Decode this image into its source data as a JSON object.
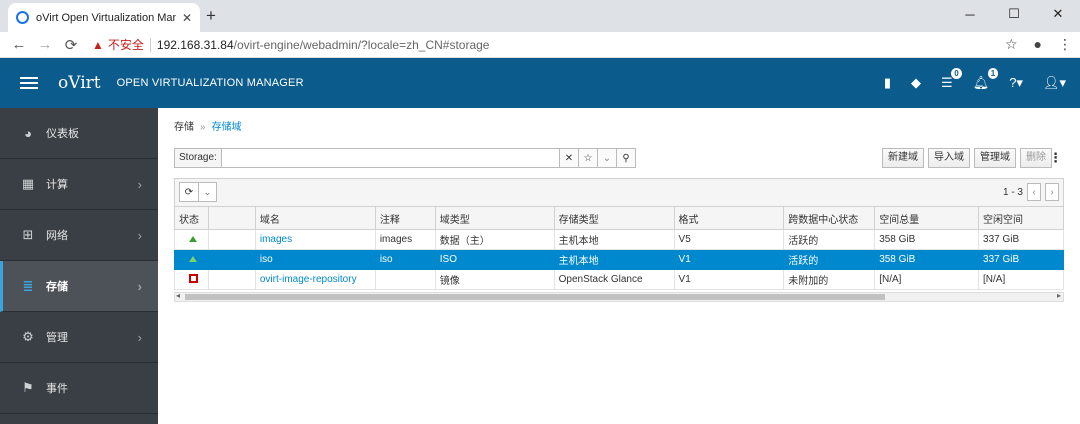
{
  "browser": {
    "tab_title": "oVirt Open Virtualization Man",
    "tab_close": "✕",
    "new_tab": "+",
    "min": "─",
    "max": "☐",
    "close": "✕",
    "insecure": "不安全",
    "url_host": "192.168.31.84",
    "url_path": "/ovirt-engine/webadmin/?locale=zh_CN#storage"
  },
  "header": {
    "logo": "oVirt",
    "product": "OPEN VIRTUALIZATION MANAGER",
    "tasks_count": "0",
    "alerts_count": "1"
  },
  "sidebar": {
    "items": [
      {
        "label": "仪表板"
      },
      {
        "label": "计算"
      },
      {
        "label": "网络"
      },
      {
        "label": "存储"
      },
      {
        "label": "管理"
      },
      {
        "label": "事件"
      }
    ]
  },
  "breadcrumb": {
    "root": "存储",
    "current": "存储域"
  },
  "search": {
    "label": "Storage:",
    "value": ""
  },
  "actions": {
    "new": "新建域",
    "import": "导入域",
    "manage": "管理域",
    "delete": "删除"
  },
  "pager": {
    "range": "1 - 3"
  },
  "table": {
    "headers": [
      "状态",
      "",
      "域名",
      "注释",
      "域类型",
      "存储类型",
      "格式",
      "跨数据中心状态",
      "空间总量",
      "空闲空间"
    ],
    "rows": [
      {
        "name": "images",
        "comment": "images",
        "domain_type": "数据（主）",
        "storage_type": "主机本地",
        "format": "V5",
        "dc_status": "活跃的",
        "total": "358 GiB",
        "free": "337 GiB"
      },
      {
        "name": "iso",
        "comment": "iso",
        "domain_type": "ISO",
        "storage_type": "主机本地",
        "format": "V1",
        "dc_status": "活跃的",
        "total": "358 GiB",
        "free": "337 GiB"
      },
      {
        "name": "ovirt-image-repository",
        "comment": "",
        "domain_type": "镜像",
        "storage_type": "OpenStack Glance",
        "format": "V1",
        "dc_status": "未附加的",
        "total": "[N/A]",
        "free": "[N/A]"
      }
    ]
  }
}
